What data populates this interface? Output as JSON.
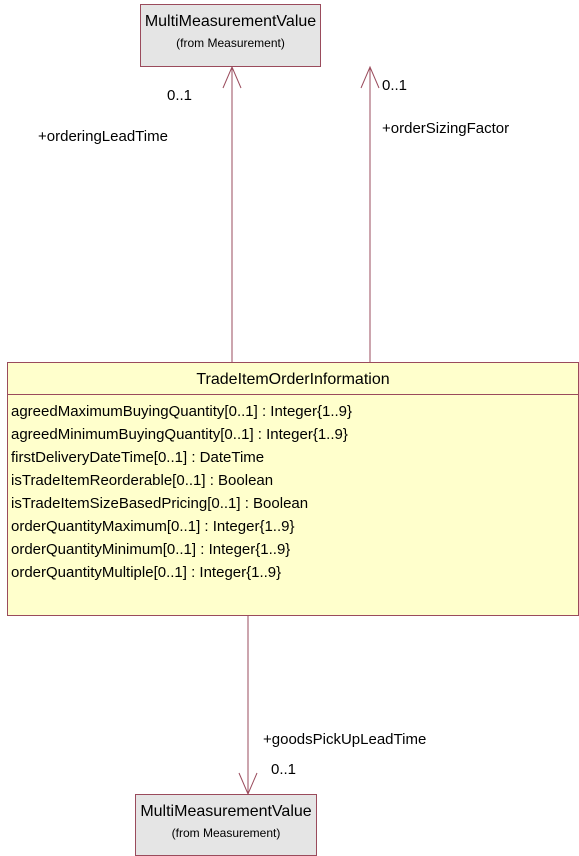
{
  "top_class": {
    "name": "MultiMeasurementValue",
    "stereotype": "(from Measurement)"
  },
  "main_class": {
    "name": "TradeItemOrderInformation",
    "attributes": [
      "agreedMaximumBuyingQuantity[0..1] : Integer{1..9}",
      "agreedMinimumBuyingQuantity[0..1] : Integer{1..9}",
      "firstDeliveryDateTime[0..1] : DateTime",
      "isTradeItemReorderable[0..1] : Boolean",
      "isTradeItemSizeBasedPricing[0..1] : Boolean",
      "orderQuantityMaximum[0..1] : Integer{1..9}",
      "orderQuantityMinimum[0..1] : Integer{1..9}",
      "orderQuantityMultiple[0..1] : Integer{1..9}"
    ]
  },
  "bottom_class": {
    "name": "MultiMeasurementValue",
    "stereotype": "(from Measurement)"
  },
  "associations": [
    {
      "role": "+orderingLeadTime",
      "multiplicity": "0..1"
    },
    {
      "role": "+orderSizingFactor",
      "multiplicity": "0..1"
    },
    {
      "role": "+goodsPickUpLeadTime",
      "multiplicity": "0..1"
    }
  ],
  "colors": {
    "border": "#9a4b5c",
    "class_fill": "#ffffcc",
    "external_fill": "#e5e5e5"
  }
}
